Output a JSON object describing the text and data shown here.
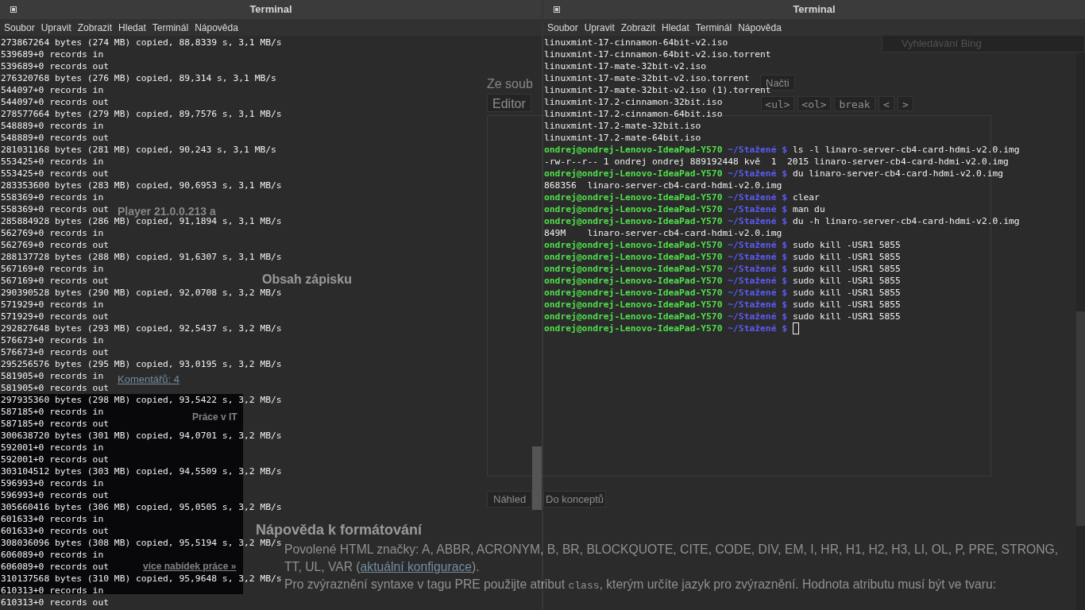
{
  "browser": {
    "search_placeholder": "Vyhledávání Bing",
    "sidebar": {
      "article_title": "Player 21.0.0.213 a",
      "comments_link": "Komentářů: 4",
      "jobs_heading": "Práce v IT",
      "more_jobs_link": "více nabídek práce »"
    },
    "main": {
      "section_heading": "Obsah zápisku",
      "file_label": "Ze soub",
      "load_button": "Načti",
      "editor_tab": "Editor",
      "tag_buttons": [
        "<ul>",
        "<ol>",
        "break",
        "<",
        ">"
      ],
      "preview_button": "Náhled",
      "draft_button": "Do konceptů",
      "help_heading": "Nápověda k formátování",
      "help_paragraphs": [
        {
          "text": "Povolené HTML značky: A, ABBR, ACRONYM, B, BR, BLOCKQUOTE, CITE, CODE, DIV, EM, I, HR, H1, H2, H3, LI, OL, P, PRE, STRONG, TT, UL, VAR (",
          "link": "aktuální konfigurace",
          "after": ")."
        },
        {
          "text": "Pro zvýraznění syntaxe v tagu PRE použijte atribut ",
          "code": "class",
          "after": ", kterým určíte jazyk pro zvýraznění. Hodnota atributu musí být ve tvaru:"
        }
      ]
    }
  },
  "terminals": [
    {
      "title": "Terminal",
      "menu": [
        "Soubor",
        "Upravit",
        "Zobrazit",
        "Hledat",
        "Terminál",
        "Nápověda"
      ],
      "lines": [
        {
          "kind": "output",
          "text": "273867264 bytes (274 MB) copied, 88,8339 s, 3,1 MB/s"
        },
        {
          "kind": "output",
          "text": "539689+0 records in"
        },
        {
          "kind": "output",
          "text": "539689+0 records out"
        },
        {
          "kind": "output",
          "text": "276320768 bytes (276 MB) copied, 89,314 s, 3,1 MB/s"
        },
        {
          "kind": "output",
          "text": "544097+0 records in"
        },
        {
          "kind": "output",
          "text": "544097+0 records out"
        },
        {
          "kind": "output",
          "text": "278577664 bytes (279 MB) copied, 89,7576 s, 3,1 MB/s"
        },
        {
          "kind": "output",
          "text": "548889+0 records in"
        },
        {
          "kind": "output",
          "text": "548889+0 records out"
        },
        {
          "kind": "output",
          "text": "281031168 bytes (281 MB) copied, 90,243 s, 3,1 MB/s"
        },
        {
          "kind": "output",
          "text": "553425+0 records in"
        },
        {
          "kind": "output",
          "text": "553425+0 records out"
        },
        {
          "kind": "output",
          "text": "283353600 bytes (283 MB) copied, 90,6953 s, 3,1 MB/s"
        },
        {
          "kind": "output",
          "text": "558369+0 records in"
        },
        {
          "kind": "output",
          "text": "558369+0 records out"
        },
        {
          "kind": "output",
          "text": "285884928 bytes (286 MB) copied, 91,1894 s, 3,1 MB/s"
        },
        {
          "kind": "output",
          "text": "562769+0 records in"
        },
        {
          "kind": "output",
          "text": "562769+0 records out"
        },
        {
          "kind": "output",
          "text": "288137728 bytes (288 MB) copied, 91,6307 s, 3,1 MB/s"
        },
        {
          "kind": "output",
          "text": "567169+0 records in"
        },
        {
          "kind": "output",
          "text": "567169+0 records out"
        },
        {
          "kind": "output",
          "text": "290390528 bytes (290 MB) copied, 92,0708 s, 3,2 MB/s"
        },
        {
          "kind": "output",
          "text": "571929+0 records in"
        },
        {
          "kind": "output",
          "text": "571929+0 records out"
        },
        {
          "kind": "output",
          "text": "292827648 bytes (293 MB) copied, 92,5437 s, 3,2 MB/s"
        },
        {
          "kind": "output",
          "text": "576673+0 records in"
        },
        {
          "kind": "output",
          "text": "576673+0 records out"
        },
        {
          "kind": "output",
          "text": "295256576 bytes (295 MB) copied, 93,0195 s, 3,2 MB/s"
        },
        {
          "kind": "output",
          "text": "581905+0 records in"
        },
        {
          "kind": "output",
          "text": "581905+0 records out"
        },
        {
          "kind": "output",
          "text": "297935360 bytes (298 MB) copied, 93,5422 s, 3,2 MB/s"
        },
        {
          "kind": "output",
          "text": "587185+0 records in"
        },
        {
          "kind": "output",
          "text": "587185+0 records out"
        },
        {
          "kind": "output",
          "text": "300638720 bytes (301 MB) copied, 94,0701 s, 3,2 MB/s"
        },
        {
          "kind": "output",
          "text": "592001+0 records in"
        },
        {
          "kind": "output",
          "text": "592001+0 records out"
        },
        {
          "kind": "output",
          "text": "303104512 bytes (303 MB) copied, 94,5509 s, 3,2 MB/s"
        },
        {
          "kind": "output",
          "text": "596993+0 records in"
        },
        {
          "kind": "output",
          "text": "596993+0 records out"
        },
        {
          "kind": "output",
          "text": "305660416 bytes (306 MB) copied, 95,0505 s, 3,2 MB/s"
        },
        {
          "kind": "output",
          "text": "601633+0 records in"
        },
        {
          "kind": "output",
          "text": "601633+0 records out"
        },
        {
          "kind": "output",
          "text": "308036096 bytes (308 MB) copied, 95,5194 s, 3,2 MB/s"
        },
        {
          "kind": "output",
          "text": "606089+0 records in"
        },
        {
          "kind": "output",
          "text": "606089+0 records out"
        },
        {
          "kind": "output",
          "text": "310137568 bytes (310 MB) copied, 95,9648 s, 3,2 MB/s"
        },
        {
          "kind": "output",
          "text": "610313+0 records in"
        },
        {
          "kind": "output",
          "text": "610313+0 records out"
        }
      ]
    },
    {
      "title": "Terminal",
      "menu": [
        "Soubor",
        "Upravit",
        "Zobrazit",
        "Hledat",
        "Terminál",
        "Nápověda"
      ],
      "lines": [
        {
          "kind": "output",
          "text": "linuxmint-17-cinnamon-64bit-v2.iso"
        },
        {
          "kind": "output",
          "text": "linuxmint-17-cinnamon-64bit-v2.iso.torrent"
        },
        {
          "kind": "output",
          "text": "linuxmint-17-mate-32bit-v2.iso"
        },
        {
          "kind": "output",
          "text": "linuxmint-17-mate-32bit-v2.iso.torrent"
        },
        {
          "kind": "output",
          "text": "linuxmint-17-mate-32bit-v2.iso (1).torrent"
        },
        {
          "kind": "output",
          "text": "linuxmint-17.2-cinnamon-32bit.iso"
        },
        {
          "kind": "output",
          "text": "linuxmint-17.2-cinnamon-64bit.iso"
        },
        {
          "kind": "output",
          "text": "linuxmint-17.2-mate-32bit.iso"
        },
        {
          "kind": "output",
          "text": "linuxmint-17.2-mate-64bit.iso"
        },
        {
          "kind": "prompt",
          "user": "ondrej@ondrej-Lenovo-IdeaPad-Y570",
          "path": "~/Stažené $",
          "command": "ls -l linaro-server-cb4-card-hdmi-v2.0.img",
          "cursor": false
        },
        {
          "kind": "output",
          "text": "-rw-r--r-- 1 ondrej ondrej 889192448 kvě  1  2015 linaro-server-cb4-card-hdmi-v2.0.img"
        },
        {
          "kind": "prompt",
          "user": "ondrej@ondrej-Lenovo-IdeaPad-Y570",
          "path": "~/Stažené $",
          "command": "du linaro-server-cb4-card-hdmi-v2.0.img",
          "cursor": false
        },
        {
          "kind": "output",
          "text": "868356  linaro-server-cb4-card-hdmi-v2.0.img"
        },
        {
          "kind": "prompt",
          "user": "ondrej@ondrej-Lenovo-IdeaPad-Y570",
          "path": "~/Stažené $",
          "command": "clear",
          "cursor": false
        },
        {
          "kind": "prompt",
          "user": "ondrej@ondrej-Lenovo-IdeaPad-Y570",
          "path": "~/Stažené $",
          "command": "man du",
          "cursor": false
        },
        {
          "kind": "prompt",
          "user": "ondrej@ondrej-Lenovo-IdeaPad-Y570",
          "path": "~/Stažené $",
          "command": "du -h linaro-server-cb4-card-hdmi-v2.0.img",
          "cursor": false
        },
        {
          "kind": "output",
          "text": "849M    linaro-server-cb4-card-hdmi-v2.0.img"
        },
        {
          "kind": "prompt",
          "user": "ondrej@ondrej-Lenovo-IdeaPad-Y570",
          "path": "~/Stažené $",
          "command": "sudo kill -USR1 5855",
          "cursor": false
        },
        {
          "kind": "prompt",
          "user": "ondrej@ondrej-Lenovo-IdeaPad-Y570",
          "path": "~/Stažené $",
          "command": "sudo kill -USR1 5855",
          "cursor": false
        },
        {
          "kind": "prompt",
          "user": "ondrej@ondrej-Lenovo-IdeaPad-Y570",
          "path": "~/Stažené $",
          "command": "sudo kill -USR1 5855",
          "cursor": false
        },
        {
          "kind": "prompt",
          "user": "ondrej@ondrej-Lenovo-IdeaPad-Y570",
          "path": "~/Stažené $",
          "command": "sudo kill -USR1 5855",
          "cursor": false
        },
        {
          "kind": "prompt",
          "user": "ondrej@ondrej-Lenovo-IdeaPad-Y570",
          "path": "~/Stažené $",
          "command": "sudo kill -USR1 5855",
          "cursor": false
        },
        {
          "kind": "prompt",
          "user": "ondrej@ondrej-Lenovo-IdeaPad-Y570",
          "path": "~/Stažené $",
          "command": "sudo kill -USR1 5855",
          "cursor": false
        },
        {
          "kind": "prompt",
          "user": "ondrej@ondrej-Lenovo-IdeaPad-Y570",
          "path": "~/Stažené $",
          "command": "sudo kill -USR1 5855",
          "cursor": false
        },
        {
          "kind": "prompt",
          "user": "ondrej@ondrej-Lenovo-IdeaPad-Y570",
          "path": "~/Stažené $",
          "cursor": true
        }
      ]
    }
  ]
}
